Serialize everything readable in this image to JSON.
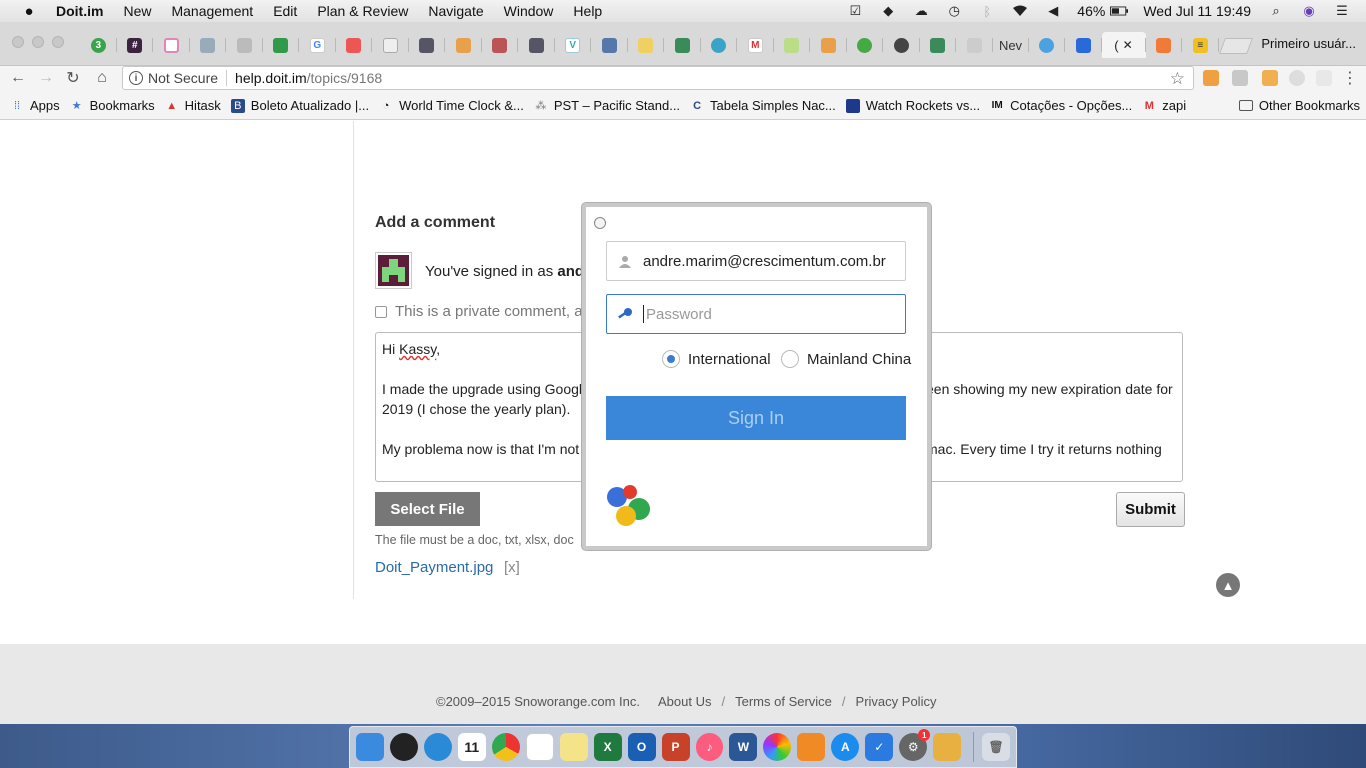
{
  "menubar": {
    "app_name": "Doit.im",
    "items": [
      "New",
      "Management",
      "Edit",
      "Plan & Review",
      "Navigate",
      "Window",
      "Help"
    ],
    "battery": "46%",
    "datetime": "Wed Jul 11  19:49"
  },
  "tabs": {
    "first_badge": "3",
    "partial_tab_label": "Nev",
    "active_tab_label": "(",
    "profile_name": "Primeiro usuár..."
  },
  "toolbar": {
    "security_label": "Not Secure",
    "url_host": "help.doit.im",
    "url_path": "/topics/9168"
  },
  "bookmarks": {
    "items": [
      "Apps",
      "Bookmarks",
      "Hitask",
      "Boleto Atualizado |...",
      "World Time Clock &...",
      "PST – Pacific Stand...",
      "Tabela Simples Nac...",
      "Watch Rockets vs...",
      "Cotações - Opções...",
      "zapi"
    ],
    "other": "Other Bookmarks"
  },
  "page": {
    "add_comment_title": "Add a comment",
    "signed_in_prefix": "You've signed in as ",
    "signed_in_user": "and",
    "private_label": "This is a private comment, a",
    "comment_lines": [
      "Hi Kassy,",
      "I made the upgrade using Google",
      "een showing my new expiration date for",
      "2019 (I chose the yearly plan).",
      "My problema now is that I'm not",
      "mac. Every time I try it returns nothing"
    ],
    "comment_squiggle": "Kassy",
    "select_file_label": "Select File",
    "submit_label": "Submit",
    "file_note": "The file must be a doc, txt, xlsx, doc",
    "attachment_name": "Doit_Payment.jpg",
    "attachment_remove": "[x]"
  },
  "footer": {
    "copyright": "©2009–2015 Snoworange.com Inc.",
    "links": [
      "About Us",
      "Terms of Service",
      "Privacy Policy"
    ]
  },
  "dialog": {
    "email_value": "andre.marim@crescimentum.com.br",
    "password_placeholder": "Password",
    "region_options": [
      "International",
      "Mainland China"
    ],
    "region_selected": "International",
    "signin_label": "Sign In"
  },
  "dock": {
    "calendar_day": "11",
    "badge_count": "1"
  },
  "colors": {
    "signin_bg": "#3a86d8",
    "link": "#2a6aa8",
    "avatar": "#5b1d3a"
  }
}
